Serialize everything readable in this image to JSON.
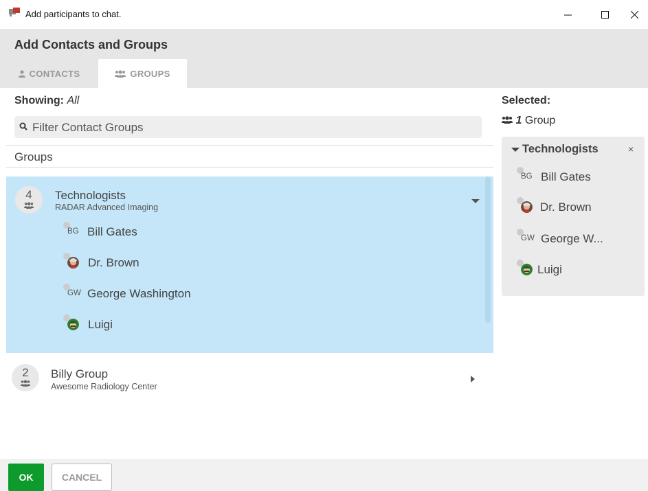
{
  "window": {
    "title": "Add participants to chat.",
    "icons": {
      "app": "chat-icon",
      "minimize": "minimize-icon",
      "maximize": "maximize-icon",
      "close": "close-icon"
    }
  },
  "header": {
    "title": "Add Contacts and Groups"
  },
  "tabs": [
    {
      "label": "CONTACTS",
      "icon": "user-icon",
      "active": false
    },
    {
      "label": "GROUPS",
      "icon": "users-icon",
      "active": true
    }
  ],
  "filter": {
    "showing_label": "Showing:",
    "showing_value": "All",
    "placeholder": "Filter Contact Groups",
    "icon": "search-icon"
  },
  "groups_header": "Groups",
  "groups": [
    {
      "count": "4",
      "name": "Technologists",
      "subtitle": "RADAR Advanced Imaging",
      "expanded": true,
      "members": [
        {
          "initials": "BG",
          "name": "Bill Gates"
        },
        {
          "initials": "",
          "name": "Dr. Brown",
          "avatar": "dr-brown-avatar"
        },
        {
          "initials": "GW",
          "name": "George Washington"
        },
        {
          "initials": "",
          "name": "Luigi",
          "avatar": "luigi-avatar"
        }
      ]
    },
    {
      "count": "2",
      "name": "Billy Group",
      "subtitle": "Awesome Radiology Center",
      "expanded": false,
      "members": []
    }
  ],
  "selected": {
    "label": "Selected:",
    "count": "1",
    "count_label": "Group",
    "panel_title": "Technologists",
    "close_symbol": "×",
    "members": [
      {
        "initials": "BG",
        "name": "Bill Gates"
      },
      {
        "initials": "",
        "name": "Dr. Brown"
      },
      {
        "initials": "GW",
        "name": "George W..."
      },
      {
        "initials": "",
        "name": "Luigi"
      }
    ]
  },
  "footer": {
    "ok_label": "OK",
    "cancel_label": "CANCEL"
  },
  "colors": {
    "selected_group_bg": "#c4e6f8",
    "ok_green": "#0c9b2c",
    "header_bg": "#e6e6e6"
  }
}
